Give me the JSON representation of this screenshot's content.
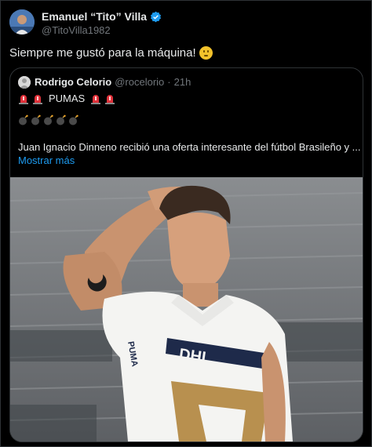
{
  "tweet": {
    "author_name": "Emanuel “Tito” Villa",
    "author_handle": "@TitoVilla1982",
    "text": "Siempre me gustó para la máquina!"
  },
  "quoted_tweet": {
    "author_name": "Rodrigo Celorio",
    "author_handle": "@rocelorio",
    "separator": "·",
    "time": "21h",
    "line1": "PUMAS",
    "text": "Juan Ignacio Dinneno recibió una oferta interesante del fútbol Brasileño y ...",
    "show_more": "Mostrar más"
  },
  "colors": {
    "background": "#000000",
    "border": "#2f3336",
    "link": "#1d9bf0",
    "verified": "#1d9bf0",
    "secondary_text": "#71767b"
  },
  "icons": [
    "verified-badge-icon",
    "siren-icon",
    "bomb-icon",
    "confused-face-emoji"
  ],
  "photo_text": {
    "sponsor": "DHL",
    "club_logo_letters": "PUMA"
  }
}
